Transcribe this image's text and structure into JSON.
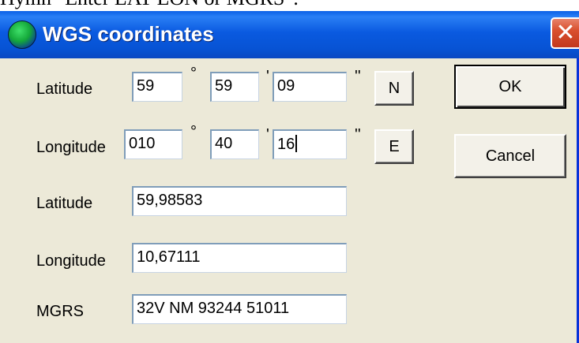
{
  "background": {
    "caption": "Hymn \"Enter LAT LON or MGRS\":"
  },
  "window": {
    "title": "WGS coordinates",
    "icon": "globe-icon",
    "close_glyph": "✕"
  },
  "dms": {
    "degree_symbol": "°",
    "minute_symbol": "'",
    "second_symbol": "''",
    "latitude": {
      "label": "Latitude",
      "degrees": "59",
      "minutes": "59",
      "seconds": "09",
      "hemisphere": "N"
    },
    "longitude": {
      "label": "Longitude",
      "degrees": "010",
      "minutes": "40",
      "seconds": "16",
      "hemisphere": "E"
    }
  },
  "decimal": {
    "latitude": {
      "label": "Latitude",
      "value": "59,98583"
    },
    "longitude": {
      "label": "Longitude",
      "value": "10,67111"
    }
  },
  "mgrs": {
    "label": "MGRS",
    "value": "32V NM 93244 51011"
  },
  "buttons": {
    "ok": "OK",
    "cancel": "Cancel"
  },
  "colors": {
    "titlebar": "#0a5ae0",
    "dialog_bg": "#ece9d8",
    "field_border": "#7f9db9",
    "close": "#d9502f"
  }
}
